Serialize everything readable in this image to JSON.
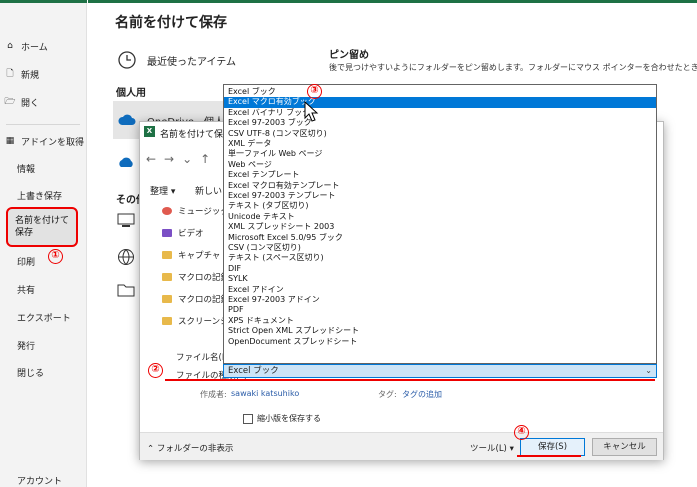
{
  "app": {
    "accent_color": "#1e7145",
    "marker_color": "#ee0000",
    "selection_color": "#0078d7"
  },
  "nav": {
    "home": "ホーム",
    "new": "新規",
    "open": "開く",
    "addins": "アドインを取得",
    "info": "情報",
    "overwrite": "上書き保存",
    "saveas": "名前を付けて保存",
    "print": "印刷",
    "share": "共有",
    "export": "エクスポート",
    "publish": "発行",
    "close": "閉じる",
    "account": "アカウント"
  },
  "main": {
    "title": "名前を付けて保存",
    "recent": "最近使ったアイテム",
    "personal": "個人用",
    "onedrive": "OneDrive - 個人",
    "other": "その他",
    "pin_title": "ピン留め",
    "pin_desc": "後で見つけやすいようにフォルダーをピン留めします。フォルダーにマウス ポインターを合わせたときに表示されるピンのアイコン"
  },
  "dialog": {
    "title": "名前を付けて保存",
    "organize": "整理 ▾",
    "new_folder": "新しいフ",
    "tree": [
      "ミュージック",
      "ビデオ",
      "キャプチャ",
      "マクロの記録 0",
      "マクロの記録 0",
      "スクリーンショッ"
    ],
    "filename_label": "ファイル名(N):",
    "filetype_label": "ファイルの種類(T):",
    "filetype_value": "Excel ブック",
    "author_label": "作成者:",
    "author_value": "sawaki katsuhiko",
    "tag_label": "タグ:",
    "tag_value": "タグの追加",
    "thumbnail": "縮小版を保存する",
    "hide_folders": "フォルダーの非表示",
    "tools": "ツール(L)",
    "save": "保存(S)",
    "cancel": "キャンセル"
  },
  "filetypes": [
    "Excel ブック",
    "Excel マクロ有効ブック",
    "Excel バイナリ ブック",
    "Excel 97-2003 ブック",
    "CSV UTF-8 (コンマ区切り)",
    "XML データ",
    "単一ファイル Web ページ",
    "Web ページ",
    "Excel テンプレート",
    "Excel マクロ有効テンプレート",
    "Excel 97-2003 テンプレート",
    "テキスト (タブ区切り)",
    "Unicode テキスト",
    "XML スプレッドシート 2003",
    "Microsoft Excel 5.0/95 ブック",
    "CSV (コンマ区切り)",
    "テキスト (スペース区切り)",
    "DIF",
    "SYLK",
    "Excel アドイン",
    "Excel 97-2003 アドイン",
    "PDF",
    "XPS ドキュメント",
    "Strict Open XML スプレッドシート",
    "OpenDocument スプレッドシート"
  ],
  "markers": {
    "m1": "①",
    "m2": "②",
    "m3": "③",
    "m4": "④"
  }
}
